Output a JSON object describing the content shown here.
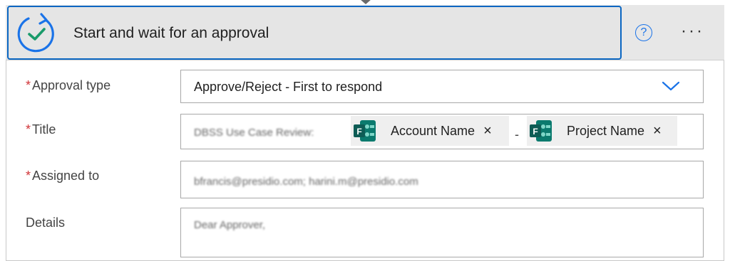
{
  "header": {
    "title": "Start and wait for an approval",
    "help_icon": "?",
    "more_icon": "···"
  },
  "fields": {
    "approval_type": {
      "label": "Approval type",
      "required_mark": "*",
      "value": "Approve/Reject - First to respond"
    },
    "title": {
      "label": "Title",
      "required_mark": "*",
      "prefix_text": "DBSS Use Case Review:",
      "tokens": [
        {
          "label": "Account Name",
          "remove": "×",
          "icon": "forms-icon"
        },
        {
          "label": "Project Name",
          "remove": "×",
          "icon": "forms-icon"
        }
      ],
      "separator": "-"
    },
    "assigned_to": {
      "label": "Assigned to",
      "required_mark": "*",
      "value": "bfrancis@presidio.com; harini.m@presidio.com"
    },
    "details": {
      "label": "Details",
      "value": "Dear Approver,"
    }
  },
  "colors": {
    "accent": "#0a66c2",
    "required": "#d13438",
    "forms_teal": "#0b7a6e"
  }
}
